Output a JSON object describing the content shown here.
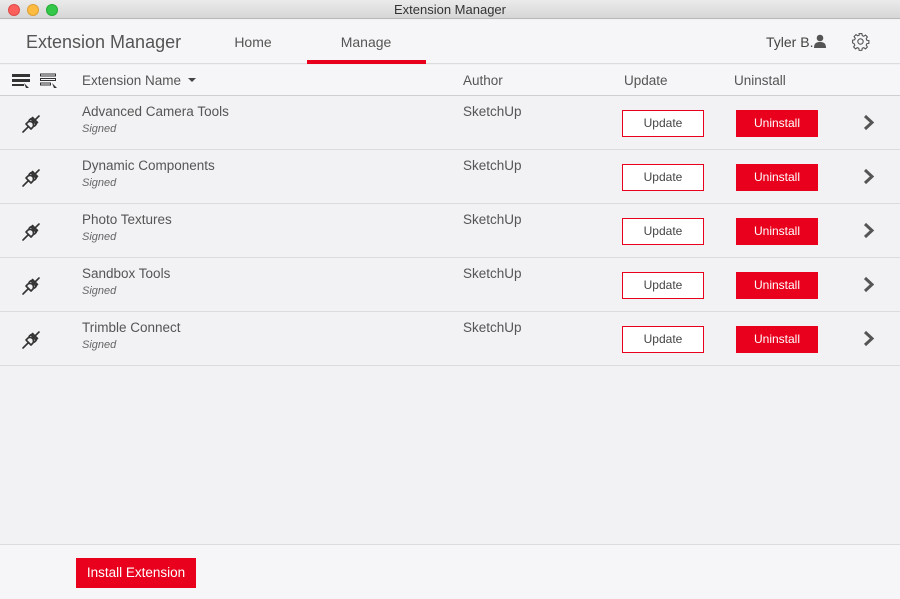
{
  "window": {
    "title": "Extension Manager"
  },
  "header": {
    "app_title": "Extension Manager",
    "tabs": [
      {
        "label": "Home",
        "active": false
      },
      {
        "label": "Manage",
        "active": true
      }
    ],
    "user_name": "Tyler B.",
    "user_icon": "user-icon",
    "settings_icon": "gear-icon"
  },
  "columns": {
    "name": "Extension Name",
    "author": "Author",
    "update": "Update",
    "uninstall": "Uninstall",
    "view_icons": [
      "list-view-icon",
      "detail-view-icon"
    ]
  },
  "extensions": [
    {
      "name": "Advanced Camera Tools",
      "status": "Signed",
      "author": "SketchUp",
      "update_label": "Update",
      "uninstall_label": "Uninstall"
    },
    {
      "name": "Dynamic Components",
      "status": "Signed",
      "author": "SketchUp",
      "update_label": "Update",
      "uninstall_label": "Uninstall"
    },
    {
      "name": "Photo Textures",
      "status": "Signed",
      "author": "SketchUp",
      "update_label": "Update",
      "uninstall_label": "Uninstall"
    },
    {
      "name": "Sandbox Tools",
      "status": "Signed",
      "author": "SketchUp",
      "update_label": "Update",
      "uninstall_label": "Uninstall"
    },
    {
      "name": "Trimble Connect",
      "status": "Signed",
      "author": "SketchUp",
      "update_label": "Update",
      "uninstall_label": "Uninstall"
    }
  ],
  "footer": {
    "install_label": "Install Extension"
  },
  "colors": {
    "accent": "#e8001c",
    "background": "#f2f1f4"
  }
}
